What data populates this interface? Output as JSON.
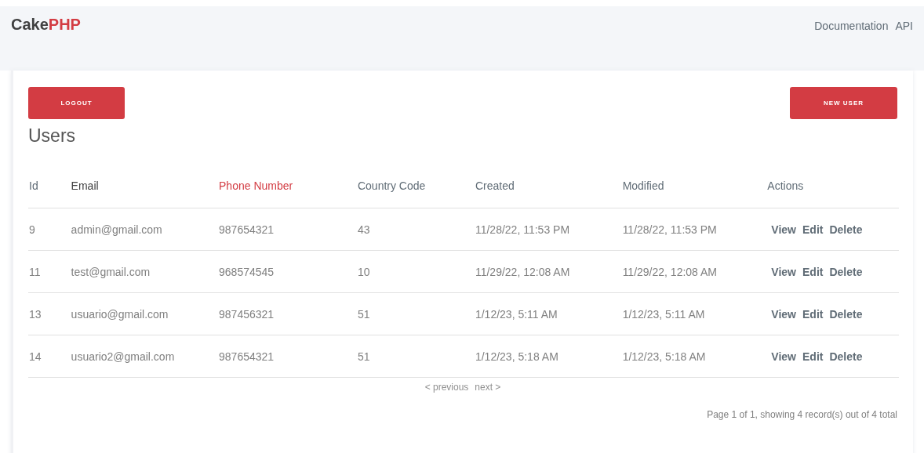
{
  "nav": {
    "logo": [
      "Cake",
      "PHP"
    ],
    "links": [
      "Documentation",
      "API"
    ]
  },
  "buttons": {
    "logout": "LOGOUT",
    "new": "NEW USER"
  },
  "title": "Users",
  "table": {
    "columns": [
      "Id",
      "Email",
      "Phone Number",
      "Country Code",
      "Created",
      "Modified",
      "Actions"
    ],
    "rows": [
      {
        "cells": [
          "9",
          "admin@gmail.com",
          "987654321",
          "43",
          "11/28/22, 11:53 PM",
          "11/28/22, 11:53 PM"
        ],
        "actions": [
          "View",
          "Edit",
          "Delete"
        ]
      },
      {
        "cells": [
          "11",
          "test@gmail.com",
          "968574545",
          "10",
          "11/29/22, 12:08 AM",
          "11/29/22, 12:08 AM"
        ],
        "actions": [
          "View",
          "Edit",
          "Delete"
        ]
      },
      {
        "cells": [
          "13",
          "usuario@gmail.com",
          "987456321",
          "51",
          "1/12/23, 5:11 AM",
          "1/12/23, 5:11 AM"
        ],
        "actions": [
          "View",
          "Edit",
          "Delete"
        ]
      },
      {
        "cells": [
          "14",
          "usuario2@gmail.com",
          "987654321",
          "51",
          "1/12/23, 5:18 AM",
          "1/12/23, 5:18 AM"
        ],
        "actions": [
          "View",
          "Edit",
          "Delete"
        ]
      }
    ]
  },
  "pagination": {
    "previous": "< previous",
    "next": "next >"
  },
  "counter": "Page 1 of 1, showing 4 record(s) out of 4 total"
}
